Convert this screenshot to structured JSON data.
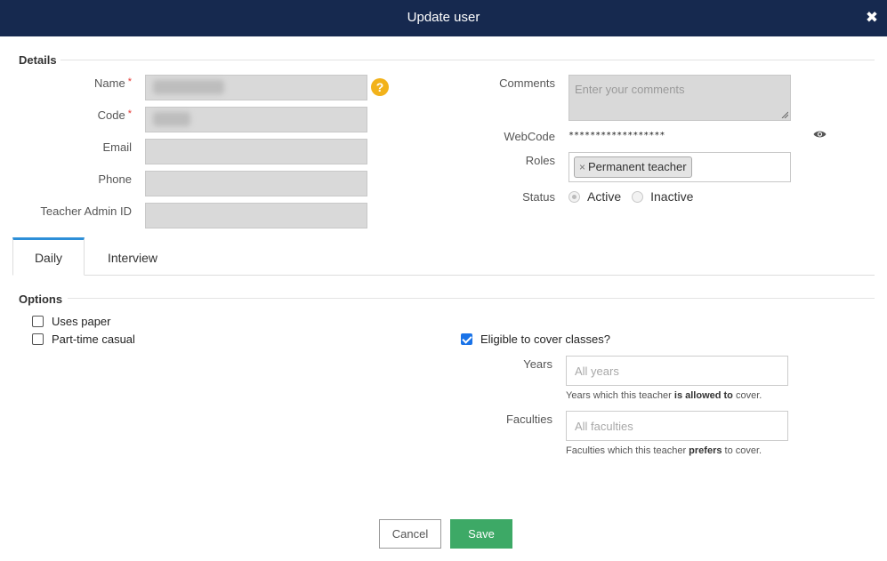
{
  "dialog": {
    "title": "Update user",
    "close_glyph": "✖"
  },
  "details": {
    "section_title": "Details",
    "fields": {
      "name_label": "Name",
      "code_label": "Code",
      "email_label": "Email",
      "phone_label": "Phone",
      "teacher_admin_id_label": "Teacher Admin ID",
      "required_marker": "*"
    },
    "help_glyph": "?",
    "comments_label": "Comments",
    "comments_placeholder": "Enter your comments",
    "webcode_label": "WebCode",
    "webcode_value": "******************",
    "eye_glyph": "👁",
    "roles_label": "Roles",
    "roles": [
      {
        "remove_glyph": "×",
        "label": "Permanent teacher"
      }
    ],
    "status_label": "Status",
    "status_options": [
      {
        "label": "Active",
        "selected": true
      },
      {
        "label": "Inactive",
        "selected": false
      }
    ]
  },
  "tabs": [
    {
      "label": "Daily",
      "active": true
    },
    {
      "label": "Interview",
      "active": false
    }
  ],
  "options": {
    "section_title": "Options",
    "uses_paper": {
      "label": "Uses paper",
      "checked": false
    },
    "part_time_casual": {
      "label": "Part-time casual",
      "checked": false
    },
    "eligible": {
      "label": "Eligible to cover classes?",
      "checked": true
    },
    "years_label": "Years",
    "years_placeholder": "All years",
    "years_hint_pre": "Years which this teacher ",
    "years_hint_bold": "is allowed to",
    "years_hint_post": " cover.",
    "faculties_label": "Faculties",
    "faculties_placeholder": "All faculties",
    "faculties_hint_pre": "Faculties which this teacher ",
    "faculties_hint_bold": "prefers",
    "faculties_hint_post": " to cover."
  },
  "footer": {
    "cancel_label": "Cancel",
    "save_label": "Save"
  },
  "colors": {
    "header_bg": "#16294f",
    "tab_active_accent": "#2d8fd8",
    "save_bg": "#3da966",
    "checkbox_checked": "#1a73e8",
    "help_icon": "#f2b21a"
  }
}
